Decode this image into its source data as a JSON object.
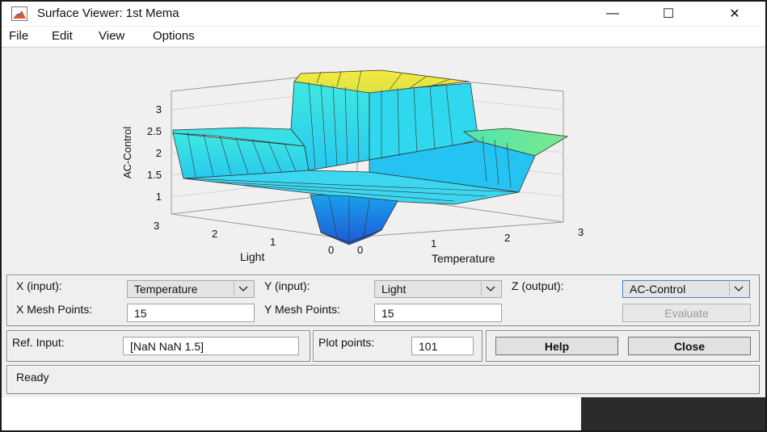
{
  "window": {
    "title": "Surface Viewer: 1st Mema",
    "icon": "matlab-membrane-icon",
    "controls": {
      "minimize": "—",
      "maximize": "☐",
      "close": "✕"
    }
  },
  "menu": [
    {
      "label": "File"
    },
    {
      "label": "Edit"
    },
    {
      "label": "View"
    },
    {
      "label": "Options"
    }
  ],
  "plot": {
    "zlabel": "AC-Control",
    "z_ticks": [
      "1",
      "1.5",
      "2",
      "2.5",
      "3"
    ],
    "light_axis_label": "Light",
    "light_ticks": [
      "0",
      "1",
      "2",
      "3"
    ],
    "temperature_axis_label": "Temperature",
    "temperature_ticks": [
      "0",
      "1",
      "2",
      "3"
    ],
    "colormap": [
      "#1a5fd8",
      "#19a8f0",
      "#22e2ec",
      "#5fe8a0",
      "#f0e84a"
    ]
  },
  "controls": {
    "x_input_label": "X (input):",
    "x_input_value": "Temperature",
    "y_input_label": "Y (input):",
    "y_input_value": "Light",
    "z_output_label": "Z (output):",
    "z_output_value": "AC-Control",
    "x_mesh_label": "X Mesh Points:",
    "x_mesh_value": "15",
    "y_mesh_label": "Y Mesh Points:",
    "y_mesh_value": "15",
    "evaluate_label": "Evaluate",
    "ref_input_label": "Ref. Input:",
    "ref_input_value": "[NaN NaN 1.5]",
    "plot_points_label": "Plot points:",
    "plot_points_value": "101",
    "help_label": "Help",
    "close_label": "Close"
  },
  "status": {
    "text": "Ready"
  },
  "chart_data": {
    "type": "surface",
    "title": "",
    "xlabel": "Temperature",
    "ylabel": "Light",
    "zlabel": "AC-Control",
    "xlim": [
      0,
      3
    ],
    "ylim": [
      0,
      3
    ],
    "zlim": [
      0.75,
      3.25
    ],
    "description_values": {
      "plateau_peak": 3.5,
      "left_plateau": 2.5,
      "right_plateau": 2.4,
      "mid_level": 1.5,
      "low_pit_min": 0.5
    }
  }
}
